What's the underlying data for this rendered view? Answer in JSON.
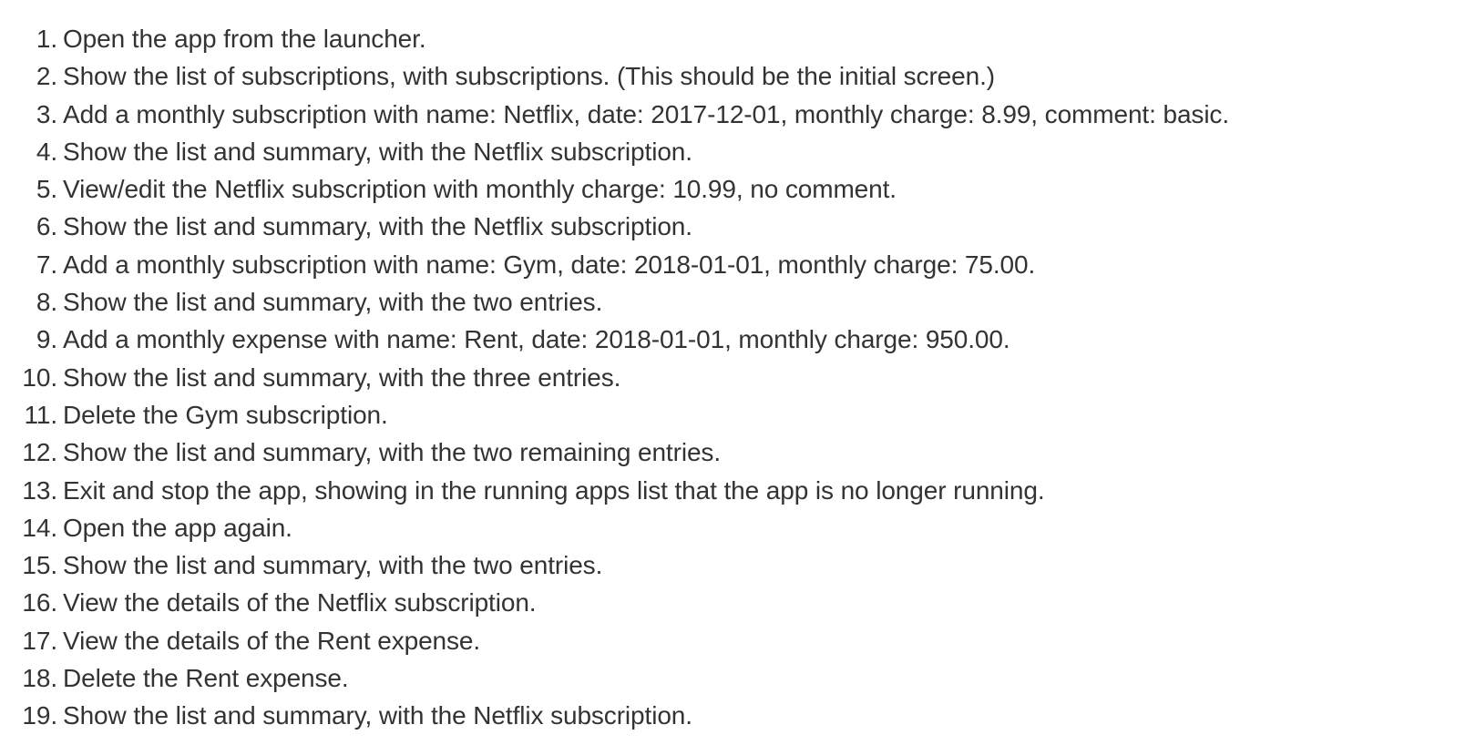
{
  "steps": [
    {
      "number": "1.",
      "text": "Open the app from the launcher."
    },
    {
      "number": "2.",
      "text": "Show the list of subscriptions, with subscriptions. (This should be the initial screen.)"
    },
    {
      "number": "3.",
      "text": "Add a monthly subscription with name: Netflix, date: 2017-12-01, monthly charge: 8.99, comment: basic."
    },
    {
      "number": "4.",
      "text": "Show the list and summary, with the Netflix subscription."
    },
    {
      "number": "5.",
      "text": "View/edit the Netflix subscription with monthly charge: 10.99, no comment."
    },
    {
      "number": "6.",
      "text": "Show the list and summary, with the Netflix subscription."
    },
    {
      "number": "7.",
      "text": "Add a monthly subscription with name: Gym, date: 2018-01-01, monthly charge: 75.00."
    },
    {
      "number": "8.",
      "text": "Show the list and summary, with the two entries."
    },
    {
      "number": "9.",
      "text": "Add a monthly expense with name: Rent, date: 2018-01-01, monthly charge: 950.00."
    },
    {
      "number": "10.",
      "text": "Show the list and summary, with the three entries."
    },
    {
      "number": "11.",
      "text": "Delete the Gym subscription."
    },
    {
      "number": "12.",
      "text": "Show the list and summary, with the two remaining entries."
    },
    {
      "number": "13.",
      "text": "Exit and stop the app, showing in the running apps list that the app is no longer running."
    },
    {
      "number": "14.",
      "text": "Open the app again."
    },
    {
      "number": "15.",
      "text": "Show the list and summary, with the two entries."
    },
    {
      "number": "16.",
      "text": "View the details of the Netflix subscription."
    },
    {
      "number": "17.",
      "text": "View the details of the Rent expense."
    },
    {
      "number": "18.",
      "text": "Delete the Rent expense."
    },
    {
      "number": "19.",
      "text": "Show the list and summary, with the Netflix subscription."
    }
  ]
}
